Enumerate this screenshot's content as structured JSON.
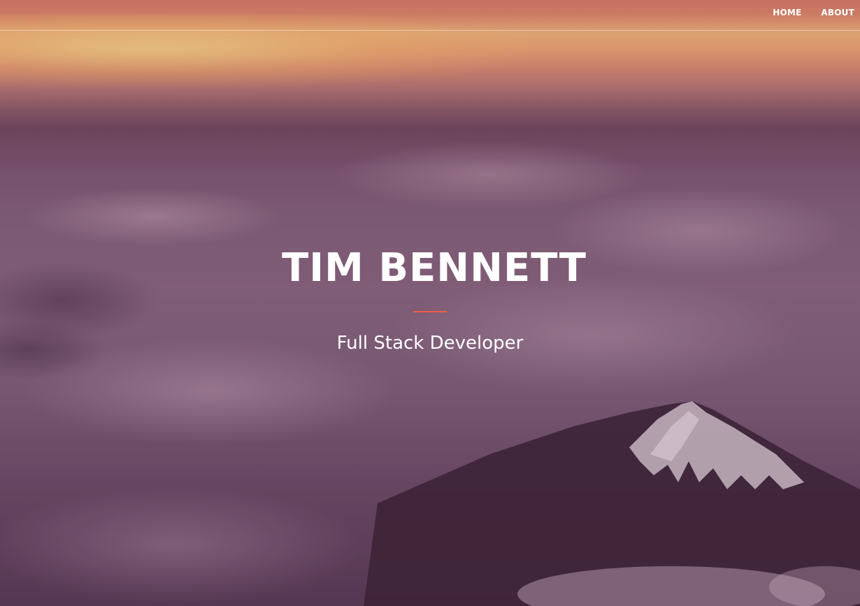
{
  "nav": {
    "items": [
      {
        "label": "HOME"
      },
      {
        "label": "ABOUT"
      }
    ]
  },
  "header": {
    "title": "TIM BENNETT",
    "subtitle": "Full Stack Developer"
  },
  "colors": {
    "accent": "#f05f40",
    "text": "#ffffff"
  }
}
